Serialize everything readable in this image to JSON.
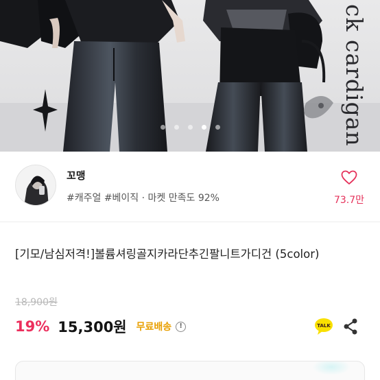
{
  "hero": {
    "script_text": "ck cardigan",
    "carousel_total": 5,
    "carousel_active": 4
  },
  "seller": {
    "name": "꼬맹",
    "tags": "#캐주얼 #베이직 · 마켓 만족도 92%",
    "like_count": "73.7만"
  },
  "product": {
    "title": "[기모/남심저격!]볼륨셔링골지카라단추긴팔니트가디건 (5color)",
    "original_price": "18,900원",
    "discount": "19%",
    "price": "15,300원",
    "shipping": "무료배송",
    "info_icon_label": "!"
  },
  "actions": {
    "talk_badge": "TALK",
    "talk_icon": "kakao-talk-icon",
    "share_icon": "share-icon",
    "like_icon": "heart-icon"
  },
  "colors": {
    "accent_pink": "#ec2f5d",
    "like_pink": "#e5315a",
    "shipping_orange": "#e89f00",
    "kakao_yellow": "#f9e000"
  }
}
